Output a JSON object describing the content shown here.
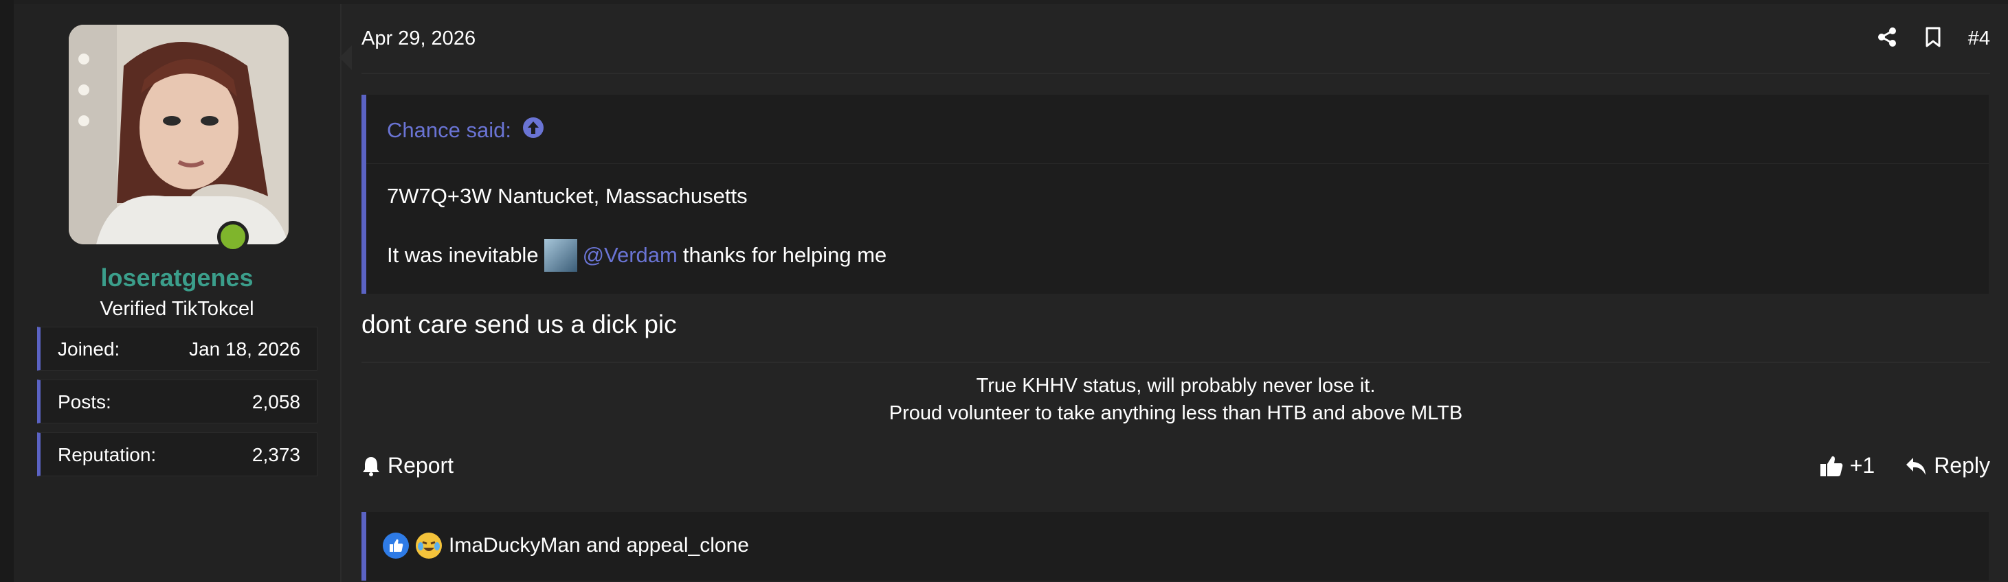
{
  "user": {
    "name": "loseratgenes",
    "title": "Verified TikTokcel",
    "stats": [
      {
        "label": "Joined:",
        "value": "Jan 18, 2026"
      },
      {
        "label": "Posts:",
        "value": "2,058"
      },
      {
        "label": "Reputation:",
        "value": "2,373"
      }
    ]
  },
  "post": {
    "date": "Apr 29, 2026",
    "number": "#4",
    "quote": {
      "author": "Chance said:",
      "line1": "7W7Q+3W Nantucket, Massachusetts",
      "line2_prefix": "It was inevitable",
      "mention": "@Verdam",
      "line2_suffix": "thanks for helping me"
    },
    "body": "dont care send us a dick pic",
    "signature": [
      "True KHHV status, will probably never lose it.",
      "Proud volunteer to take anything less than HTB and above MLTB"
    ],
    "actions": {
      "report": "Report",
      "like_count": "+1",
      "reply": "Reply"
    },
    "reactions": "ImaDuckyMan and appeal_clone"
  },
  "colors": {
    "accent": "#5b63c4",
    "username": "#3b9e8b",
    "online": "#7fb52c",
    "link": "#6a74d4"
  }
}
